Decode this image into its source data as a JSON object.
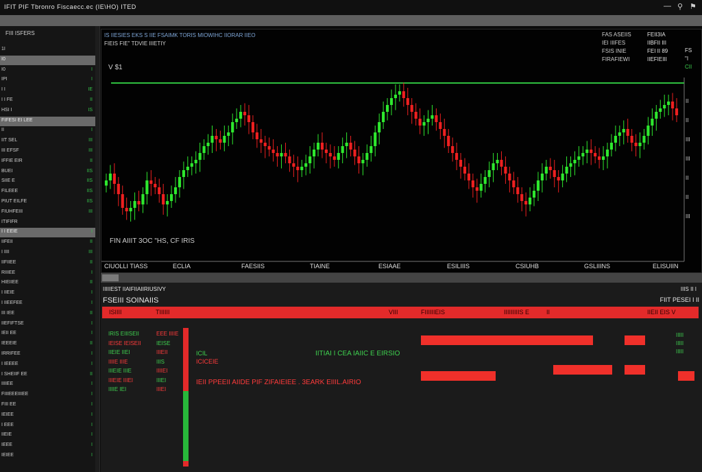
{
  "window": {
    "title": "IFIT PIF Tbronro Fiscaecc.ec  (IE\\HO) ITED",
    "controls": [
      "—",
      "⚲",
      "⚑"
    ]
  },
  "sidebar": {
    "title": "FIII ISFERS",
    "items": [
      {
        "label": "1I",
        "value": ""
      },
      {
        "label": "I0",
        "value": "",
        "highlight": true
      },
      {
        "label": "I0",
        "value": "I"
      },
      {
        "label": "IPI",
        "value": "I"
      },
      {
        "label": "I I",
        "value": "IE"
      },
      {
        "label": "I I FE",
        "value": "II"
      },
      {
        "label": "HSI I",
        "value": "IS"
      },
      {
        "label": "FIFESI EI LEE",
        "value": "",
        "highlight": true
      },
      {
        "label": "II",
        "value": "I"
      },
      {
        "label": "IIT SEL",
        "value": "III"
      },
      {
        "label": "III EFSF",
        "value": "III"
      },
      {
        "label": "IFFIE EIR",
        "value": "II"
      },
      {
        "label": "BUEI",
        "value": "IIS"
      },
      {
        "label": "SIIE E",
        "value": "IIS"
      },
      {
        "label": "FILEEE",
        "value": "IIS"
      },
      {
        "label": "PIUT EILFE",
        "value": "IIS"
      },
      {
        "label": "FIUHFEIII",
        "value": "III"
      },
      {
        "label": "ITIFIFR",
        "value": ""
      },
      {
        "label": "I I  EEIE",
        "value": "I",
        "highlight": true
      },
      {
        "label": "IIFEII",
        "value": "II"
      },
      {
        "label": "I IIII",
        "value": "III"
      },
      {
        "label": "IIFIIEE",
        "value": "II"
      },
      {
        "label": "RIIIEE",
        "value": "I"
      },
      {
        "label": "HIEIIEE",
        "value": "II"
      },
      {
        "label": "I IIEIE",
        "value": "I"
      },
      {
        "label": "I IIEEFEE",
        "value": "I"
      },
      {
        "label": "III IEE",
        "value": "II"
      },
      {
        "label": "IIEFIFTSE",
        "value": "I"
      },
      {
        "label": "IEII EE",
        "value": "I"
      },
      {
        "label": "IEEEIE",
        "value": "II"
      },
      {
        "label": "IRRIFEE",
        "value": "I"
      },
      {
        "label": "I IEEEE",
        "value": "I"
      },
      {
        "label": "I SHEIIF EE",
        "value": "II"
      },
      {
        "label": "IIIIEE",
        "value": "I"
      },
      {
        "label": "FIIIEEEIIIEE",
        "value": "I"
      },
      {
        "label": "FIII EE",
        "value": "I"
      },
      {
        "label": "IEIEE",
        "value": "I"
      },
      {
        "label": "I EEE",
        "value": "I"
      },
      {
        "label": "IIEIE",
        "value": "I"
      },
      {
        "label": "IEEE",
        "value": "I"
      },
      {
        "label": "IEIEE",
        "value": "I"
      }
    ]
  },
  "chart": {
    "header_line1": "IS IIESIES EKS S IIE FSAIMK  TORIS MIOWIHC IIORAR IIEO",
    "header_line2": "FIEIS FIE\" TDVIE IIIETIY",
    "price_label": "V $1",
    "bottom_note": "FIN AIIIT 3OC \"HS, CF IRIS",
    "stats": [
      {
        "label": "FAS ASEIIS",
        "value": "FEII3IA"
      },
      {
        "label": "IEI IIIFES",
        "value": "IIBFII III"
      },
      {
        "label": "FSIS INIE",
        "value": "FEI II 89"
      },
      {
        "label": "FIRAFIEWI",
        "value": "IIEFIEIII"
      }
    ],
    "right_edge": [
      {
        "label": "FS",
        "color": "#e0e0e0"
      },
      {
        "label": "\"I",
        "color": "#e0e0e0"
      },
      {
        "label": "CII",
        "color": "#3ed14f"
      }
    ],
    "right_axis_labels": [
      "II",
      "II",
      "III",
      "III",
      "II",
      "II",
      "III"
    ],
    "x_labels": [
      "CIUOLLI TIASS",
      "ECLIA",
      "FAESIIS",
      "TIAINE",
      "ESIAAE",
      "ESILIIIS",
      "CSIUHB",
      "GSLIIINS",
      "ELISUIIN"
    ],
    "resistance_line_color": "#2fbf3f",
    "bull_color": "#2ee82e",
    "bear_color": "#ee2020"
  },
  "chart_data": {
    "type": "candlestick",
    "x_labels": [
      "CIUOLLI TIASS",
      "ECLIA",
      "FAESIIS",
      "TIAINE",
      "ESIAAE",
      "ESILIIIS",
      "CSIUHB",
      "GSLIIINS",
      "ELISUIIN"
    ],
    "resistance_level": 100,
    "ylim": [
      0,
      100
    ],
    "close": [
      44,
      48,
      42,
      36,
      28,
      26,
      28,
      32,
      30,
      36,
      44,
      42,
      40,
      36,
      30,
      32,
      36,
      40,
      46,
      50,
      52,
      54,
      56,
      60,
      64,
      66,
      70,
      68,
      66,
      70,
      72,
      78,
      80,
      84,
      82,
      78,
      72,
      68,
      66,
      64,
      62,
      60,
      58,
      60,
      58,
      54,
      52,
      50,
      52,
      54,
      58,
      62,
      66,
      62,
      60,
      58,
      56,
      60,
      64,
      66,
      62,
      58,
      54,
      56,
      60,
      64,
      72,
      78,
      84,
      88,
      92,
      94,
      96,
      92,
      88,
      84,
      80,
      76,
      78,
      80,
      82,
      78,
      74,
      70,
      64,
      60,
      56,
      52,
      48,
      44,
      40,
      38,
      42,
      46,
      50,
      54,
      56,
      52,
      48,
      44,
      40,
      36,
      32,
      30,
      34,
      38,
      44,
      48,
      52,
      50,
      46,
      44,
      48,
      52,
      54,
      56,
      58,
      60,
      62,
      60,
      58,
      56,
      58,
      62,
      66,
      70,
      72,
      74,
      70,
      66,
      64,
      66,
      70,
      76,
      80,
      84,
      86,
      88,
      90,
      86,
      82
    ],
    "bull_color": "#2ee82e",
    "bear_color": "#ee2020"
  },
  "orders": {
    "title1": "IIIIIEST IIAIFIIAIIRIUSIVY",
    "title2": "FSEIII  SOINAIIS",
    "right1": "IIIS  II I",
    "right2": "FIIT PESEI I  II",
    "headers": [
      "ISIIII",
      "TIIIIII",
      "VIII",
      "FIIIIIIEIS",
      "IIIIIIIIIS  E",
      "II",
      "IIEII EIS  V"
    ],
    "left_rows": [
      {
        "a": "IRIS  EIIISEII",
        "b": "EEE IIIIE"
      },
      {
        "a": "IEISE  IEISEII",
        "b": "IEISE"
      },
      {
        "a": "IIEIE  IIEI",
        "b": "IIIEII"
      },
      {
        "a": "IIIIE  IIIE",
        "b": "IIIS"
      },
      {
        "a": "IIIEIE  IIIE",
        "b": "IIIIEI"
      },
      {
        "a": "IIIEIE  IIIEI",
        "b": "IIIEI"
      },
      {
        "a": "IIIIE  IEI",
        "b": "IIIEI"
      }
    ],
    "mid_green1": "ICIL",
    "mid_red1": "ICICEIE",
    "mid_green2": "IITIAI I CEA IAIIC  E EIRSIO",
    "mid_red2": "IEII   PPEEII AIIDE PIF  ZIFAIEIEE  .  3EARK  EIIIL.AIRIO",
    "right_rows": [
      "IIIII",
      "IIIII",
      "IIIII"
    ]
  }
}
